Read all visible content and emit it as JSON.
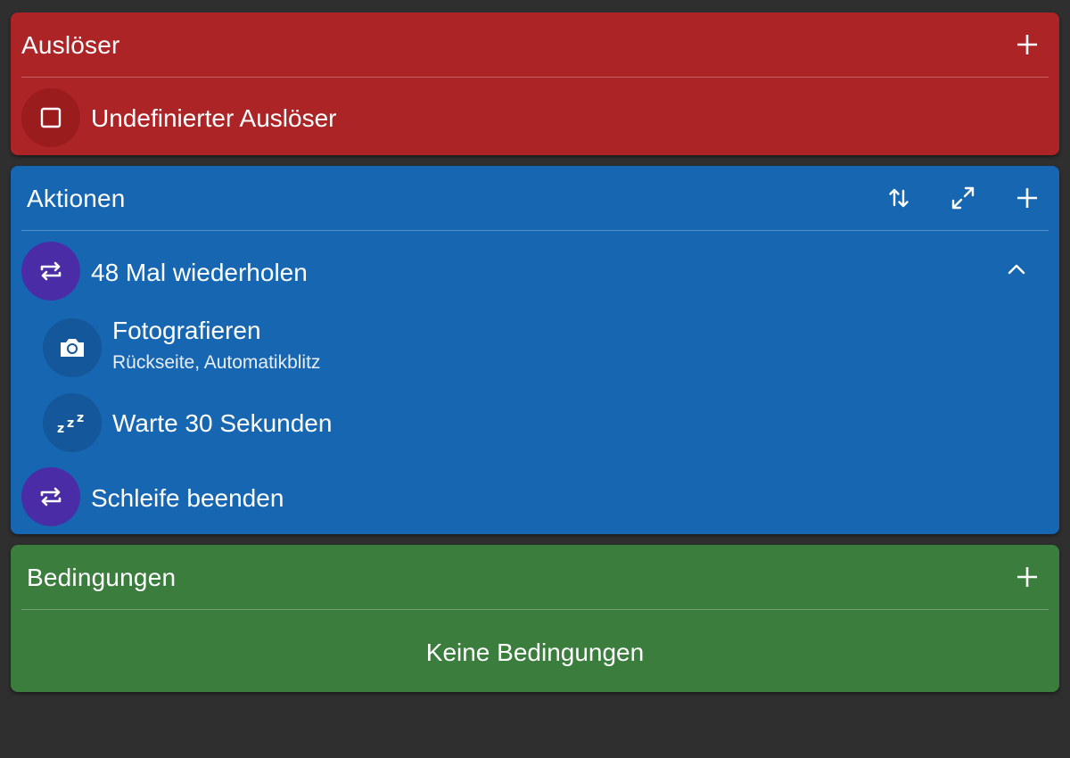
{
  "colors": {
    "background": "#2f2f2f",
    "triggers": "#ad2426",
    "actions": "#1766b2",
    "conditions": "#3a7d3c",
    "loop_circle": "#4a2ca6"
  },
  "triggers": {
    "title": "Auslöser",
    "add_icon": "plus-icon",
    "items": [
      {
        "icon": "checkbox-outline-icon",
        "label": "Undefinierter Auslöser"
      }
    ]
  },
  "actions": {
    "title": "Aktionen",
    "toolbar_icons": [
      "reorder-arrows-icon",
      "expand-icon",
      "plus-icon"
    ],
    "items": [
      {
        "icon": "repeat-icon",
        "label": "48 Mal wiederholen",
        "expanded": true
      },
      {
        "icon": "camera-icon",
        "label": "Fotografieren",
        "detail": "Rückseite, Automatikblitz"
      },
      {
        "icon": "sleep-zzz-icon",
        "label": "Warte 30 Sekunden"
      },
      {
        "icon": "repeat-icon",
        "label": "Schleife beenden"
      }
    ]
  },
  "conditions": {
    "title": "Bedingungen",
    "add_icon": "plus-icon",
    "empty_text": "Keine Bedingungen"
  }
}
